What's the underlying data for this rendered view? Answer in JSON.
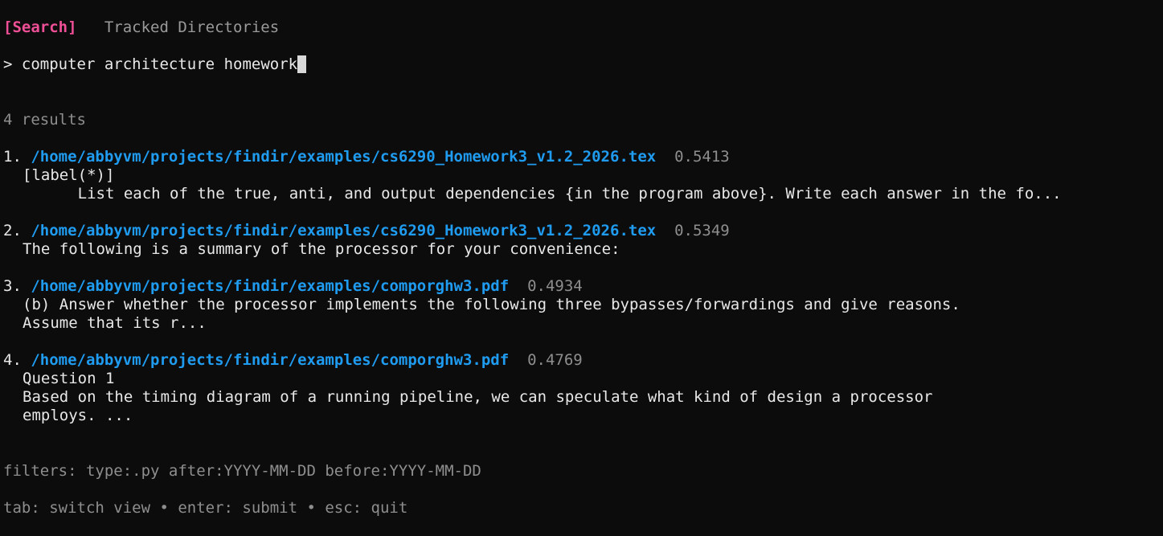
{
  "tabs": [
    {
      "label": "[Search]",
      "active": true
    },
    {
      "label": "Tracked Directories",
      "active": false
    }
  ],
  "query": {
    "prompt": ">",
    "value": "computer architecture homework"
  },
  "results_count": "4 results",
  "results": [
    {
      "index": "1.",
      "path": "/home/abbyvm/projects/findir/examples/cs6290_Homework3_v1.2_2026.tex",
      "score": "0.5413",
      "snippet": [
        "[label(*)]",
        "      List each of the true, anti, and output dependencies {in the program above}. Write each answer in the fo..."
      ]
    },
    {
      "index": "2.",
      "path": "/home/abbyvm/projects/findir/examples/cs6290_Homework3_v1.2_2026.tex",
      "score": "0.5349",
      "snippet": [
        "The following is a summary of the processor for your convenience:"
      ]
    },
    {
      "index": "3.",
      "path": "/home/abbyvm/projects/findir/examples/comporghw3.pdf",
      "score": "0.4934",
      "snippet": [
        "(b) Answer whether the processor implements the following three bypasses/forwardings and give reasons.",
        "Assume that its r..."
      ]
    },
    {
      "index": "4.",
      "path": "/home/abbyvm/projects/findir/examples/comporghw3.pdf",
      "score": "0.4769",
      "snippet": [
        "Question 1",
        "Based on the timing diagram of a running pipeline, we can speculate what kind of design a processor",
        "employs. ..."
      ]
    }
  ],
  "filters": "filters: type:.py after:YYYY-MM-DD before:YYYY-MM-DD",
  "help": "tab: switch view • enter: submit • esc: quit",
  "colors": {
    "background": "#0c0c0c",
    "active_tab": "#ef4f97",
    "path": "#1f9bf0",
    "muted": "#8e8e8e"
  }
}
